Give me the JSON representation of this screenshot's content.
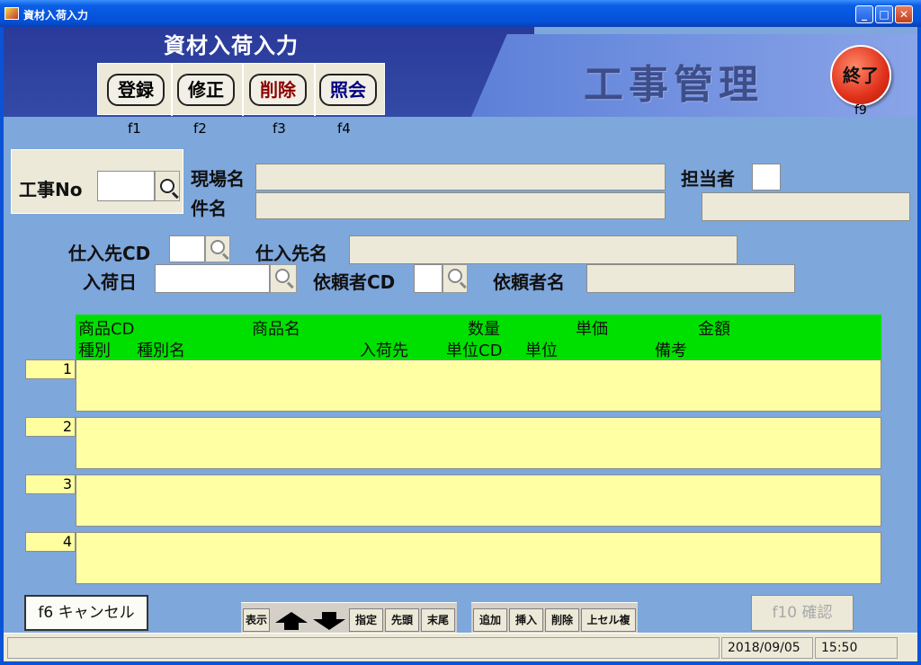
{
  "window": {
    "title": "資材入荷入力",
    "minimize": "_",
    "maximize": "□",
    "close": "✕"
  },
  "header": {
    "screen_title": "資材入荷入力",
    "app_name": "工事管理",
    "modes": [
      {
        "label": "登録",
        "key": "f1",
        "color": "#000000"
      },
      {
        "label": "修正",
        "key": "f2",
        "color": "#000000"
      },
      {
        "label": "削除",
        "key": "f3",
        "color": "#8b0000"
      },
      {
        "label": "照会",
        "key": "f4",
        "color": "#000080"
      }
    ],
    "exit": {
      "label": "終了",
      "key": "f9"
    }
  },
  "form": {
    "kouji_no_label": "工事No",
    "genba_label": "現場名",
    "kenmei_label": "件名",
    "tantou_label": "担当者",
    "shiiresaki_cd_label": "仕入先CD",
    "shiiresaki_name_label": "仕入先名",
    "nyuka_date_label": "入荷日",
    "iraisha_cd_label": "依頼者CD",
    "iraisha_name_label": "依頼者名"
  },
  "grid": {
    "header_row1": [
      "商品CD",
      "商品名",
      "数量",
      "単価",
      "金額"
    ],
    "header_row2": [
      "種別",
      "種別名",
      "入荷先",
      "単位CD",
      "単位",
      "備考"
    ],
    "rows": [
      "1",
      "2",
      "3",
      "4"
    ]
  },
  "bottom": {
    "cancel_label": "f6 キャンセル",
    "confirm_label": "f10 確認",
    "nav_buttons": {
      "show": "表示",
      "specify": "指定",
      "first": "先頭",
      "last": "末尾"
    },
    "edit_buttons": {
      "add": "追加",
      "insert": "挿入",
      "delete": "削除",
      "copy_above": "上セル複写"
    }
  },
  "status": {
    "date": "2018/09/05",
    "time": "15:50"
  }
}
